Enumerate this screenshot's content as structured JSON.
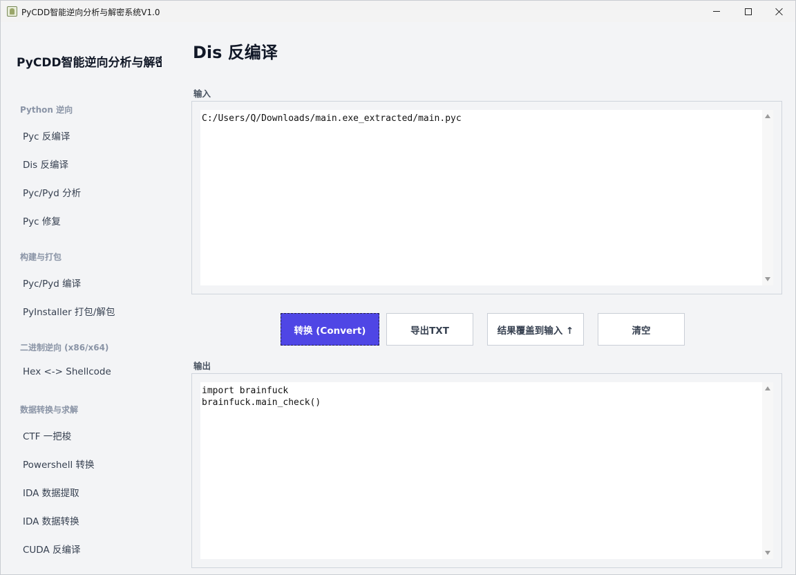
{
  "window": {
    "title": "PyCDD智能逆向分析与解密系统V1.0"
  },
  "sidebar": {
    "brand": "PyCDD智能逆向分析与解密",
    "sections": [
      {
        "title": "Python 逆向",
        "items": [
          "Pyc 反编译",
          "Dis 反编译",
          "Pyc/Pyd 分析",
          "Pyc 修复"
        ]
      },
      {
        "title": "构建与打包",
        "items": [
          "Pyc/Pyd 编译",
          "PyInstaller 打包/解包"
        ]
      },
      {
        "title": "二进制逆向 (x86/x64)",
        "items": [
          "Hex <-> Shellcode"
        ]
      },
      {
        "title": "数据转换与求解",
        "items": [
          "CTF 一把梭",
          "Powershell 转换",
          "IDA 数据提取",
          "IDA 数据转换",
          "CUDA 反编译"
        ]
      }
    ]
  },
  "main": {
    "title": "Dis 反编译",
    "input_label": "输入",
    "input_value": "C:/Users/Q/Downloads/main.exe_extracted/main.pyc",
    "output_label": "输出",
    "output_value": "import brainfuck\nbrainfuck.main_check()",
    "buttons": {
      "convert": "转换 (Convert)",
      "export": "导出TXT",
      "overwrite": "结果覆盖到输入 ↑",
      "clear": "清空"
    }
  },
  "colors": {
    "accent": "#4f46e5",
    "background": "#f3f4f6"
  }
}
